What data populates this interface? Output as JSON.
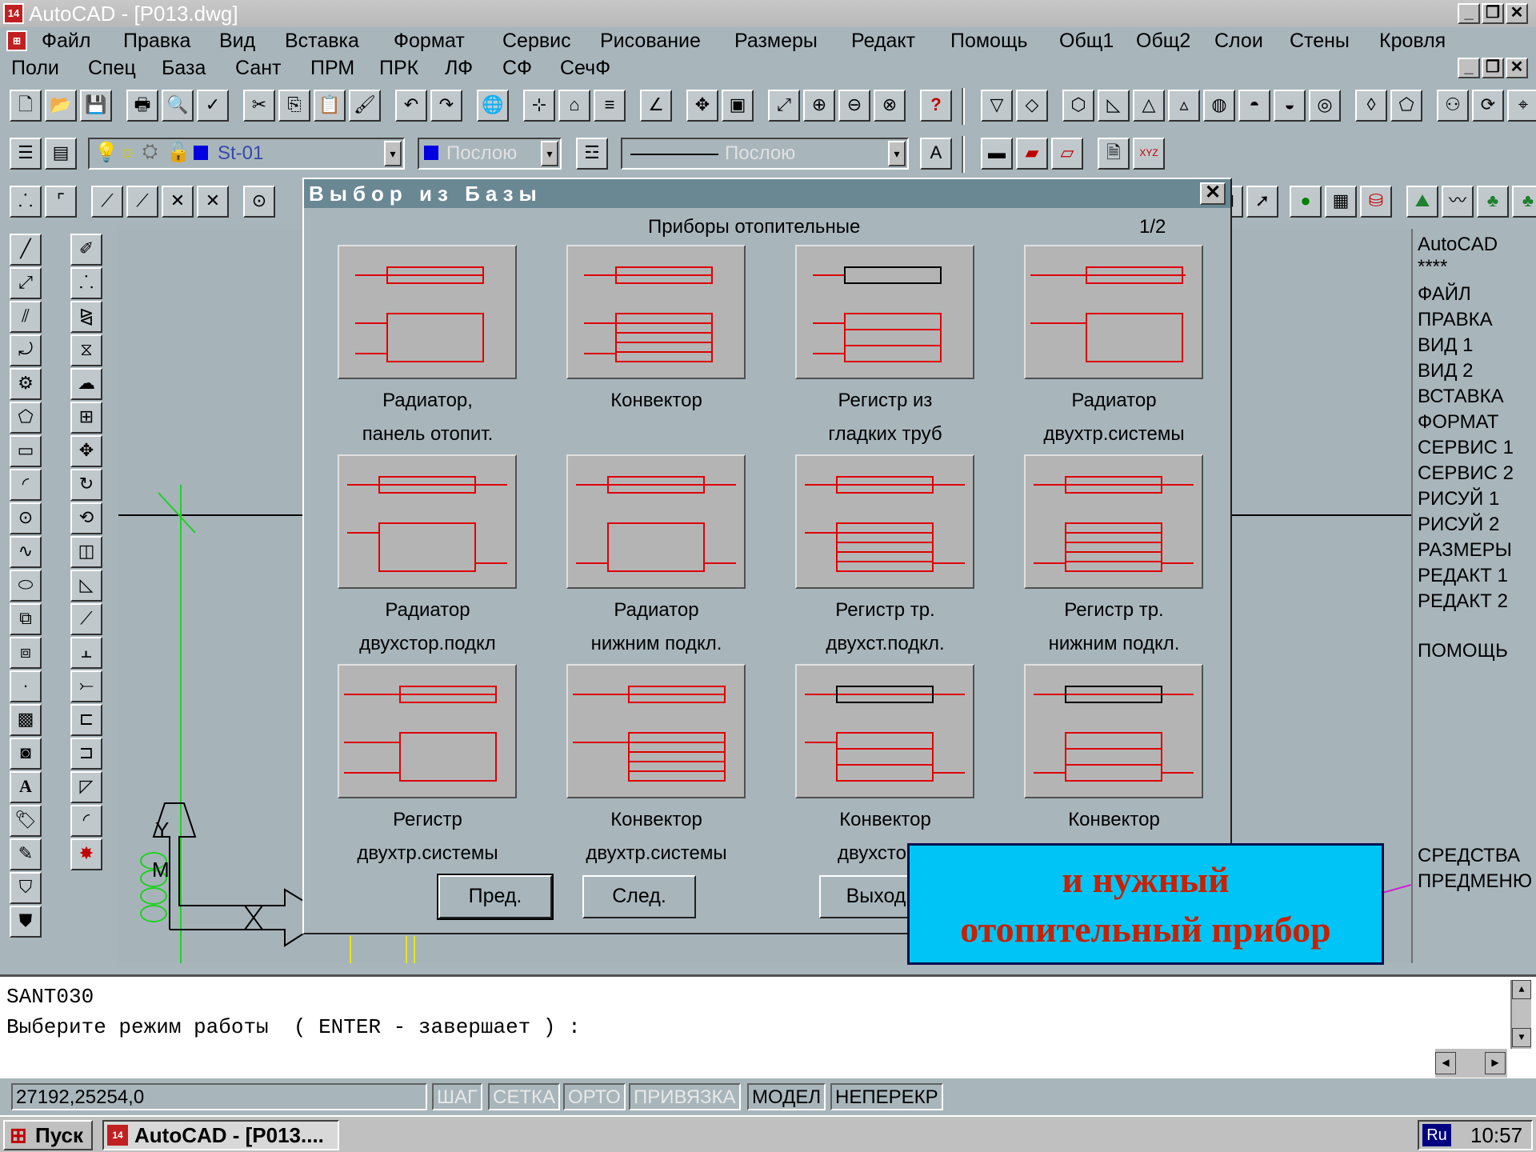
{
  "window": {
    "title": "AutoCAD - [P013.dwg]",
    "app_icon_text": "14"
  },
  "menu_row1": [
    "Файл",
    "Правка",
    "Вид",
    "Вставка",
    "Формат",
    "Сервис",
    "Рисование",
    "Размеры",
    "Редакт",
    "Помощь",
    "Общ1",
    "Общ2",
    "Слои",
    "Стены",
    "Кровля"
  ],
  "menu_row2": [
    "Поли",
    "Спец",
    "База",
    "Сант",
    "ПРМ",
    "ПРК",
    "ЛФ",
    "СФ",
    "СечФ"
  ],
  "properties_bar": {
    "layer": "St-01",
    "color": "Послою",
    "linetype": "Послою"
  },
  "dialog": {
    "title": "Выбор из Базы",
    "category": "Приборы отопительные",
    "page": "1/2",
    "items": [
      {
        "line1": "Радиатор,",
        "line2": "панель отопит."
      },
      {
        "line1": "Конвектор",
        "line2": ""
      },
      {
        "line1": "Регистр из",
        "line2": "гладких труб"
      },
      {
        "line1": "Радиатор",
        "line2": "двухтр.системы"
      },
      {
        "line1": "Радиатор",
        "line2": "двухстор.подкл"
      },
      {
        "line1": "Радиатор",
        "line2": "нижним подкл."
      },
      {
        "line1": "Регистр тр.",
        "line2": "двухст.подкл."
      },
      {
        "line1": "Регистр тр.",
        "line2": "нижним подкл."
      },
      {
        "line1": "Регистр",
        "line2": "двухтр.системы"
      },
      {
        "line1": "Конвектор",
        "line2": "двухтр.системы"
      },
      {
        "line1": "Конвектор",
        "line2": "двухстор.п"
      },
      {
        "line1": "Конвектор",
        "line2": ""
      }
    ],
    "buttons": {
      "prev": "Пред.",
      "next": "След.",
      "exit": "Выход"
    }
  },
  "screen_menu": {
    "header1": "AutoCAD",
    "header2": "****",
    "items": [
      "ФАЙЛ",
      "ПРАВКА",
      "ВИД 1",
      "ВИД 2",
      "ВСТАВКА",
      "ФОРМАТ",
      "СЕРВИС 1",
      "СЕРВИС 2",
      "РИСУЙ 1",
      "РИСУЙ 2",
      "РАЗМЕРЫ",
      "РЕДАКТ 1",
      "РЕДАКТ 2"
    ],
    "help": "ПОМОЩЬ",
    "tools1": "СРЕДСТВА",
    "tools2": "ПРЕДМЕНЮ"
  },
  "annotation": {
    "line1": "и нужный",
    "line2": "отопительный прибор"
  },
  "command_line": {
    "line1": "SANT030",
    "line2": "Выберите режим работы  ( ENTER - завершает ) :"
  },
  "status_bar": {
    "coords": "27192,25254,0",
    "modes": [
      "ШАГ",
      "СЕТКА",
      "ОРТО",
      "ПРИВЯЗКА",
      "МОДЕЛ",
      "НЕПЕРЕКР"
    ]
  },
  "taskbar": {
    "start": "Пуск",
    "task": "AutoCAD - [P013....",
    "lang": "Ru",
    "clock": "10:57"
  },
  "ucs": {
    "y_label": "Y",
    "m_label": "M"
  }
}
